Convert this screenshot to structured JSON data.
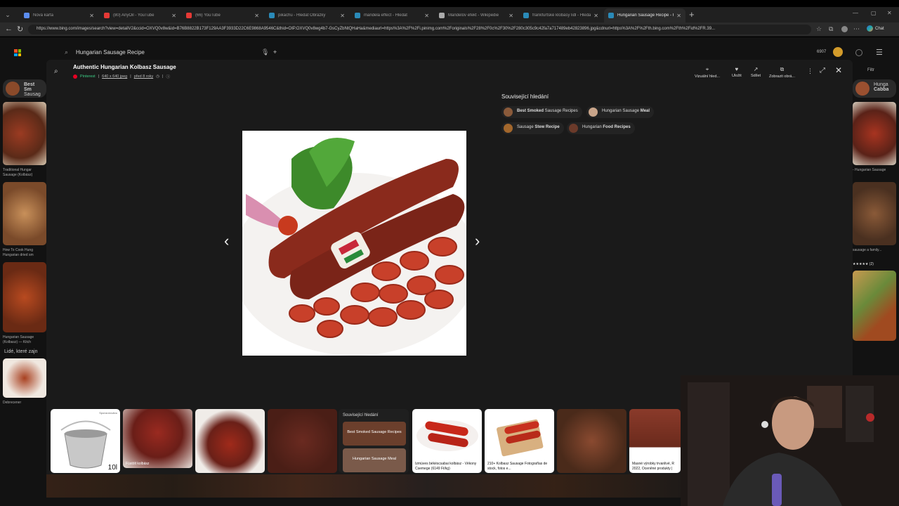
{
  "browser": {
    "tabs": [
      {
        "title": "Nová karta",
        "fav": "#5b8def",
        "active": false
      },
      {
        "title": "(80) AnyOil - YouTube",
        "fav": "#e53935",
        "active": false
      },
      {
        "title": "(66) YouTube",
        "fav": "#e53935",
        "active": false
      },
      {
        "title": "pikachu - Hledat Obrázky",
        "fav": "#2a8ab8",
        "active": false
      },
      {
        "title": "mandela effect - Hledat",
        "fav": "#2a8ab8",
        "active": false
      },
      {
        "title": "Mandelův efekt - Wikipedie",
        "fav": "#aaaaaa",
        "active": false
      },
      {
        "title": "frankfurtské klobásy lidl - Hledat",
        "fav": "#2a8ab8",
        "active": false
      },
      {
        "title": "Hungarian Sausage Recipe - Hledat",
        "fav": "#2a8ab8",
        "active": true
      }
    ],
    "url": "https://www.bing.com/images/search?view=detailV2&ccid=OXVQ0v8w&id=B76B8822B173F129AA3F3933D22C6E9868A9546C&thid=OIP.OXVQ0v8wg4b7-GsCyZbNtQHaHa&mediaurl=https%3A%2F%2Fi.pinimg.com%2Foriginals%2F28%2F0c%2F30%2F280c305c9c42fa7a717489eb42823896.jpg&cdnurl=https%3A%2F%2Fth.bing.com%2Fth%2Fid%2FR.39...",
    "chat_label": "Chat"
  },
  "bing": {
    "query": "Hungarian Sausage Recipe",
    "points": "6907",
    "filter_label": "Filtr",
    "left_pill": {
      "line1": "Best Sm",
      "line2": "Sausag"
    },
    "right_pill": {
      "line1": "Hunga",
      "line2": "Cabba"
    },
    "left_captions": [
      "Traditional Hungar Sausage (Kolbász)",
      "How To Cook Hung Hungarian dried sm",
      "Hungarian Sausage (Kolbasz) — Kitch"
    ],
    "right_captions": [
      "- Hungarian Sausage",
      "sausage a family...",
      ""
    ],
    "right_stars": "★★★★★ (2)",
    "people_also": "Lidé, které zajn",
    "people_caption": "Debrecener"
  },
  "detail": {
    "title": "Authentic Hungarian Kolbasz Sausage",
    "source": "Pinterest",
    "size": "640 x 640 jpeg",
    "age": "před 8 roky",
    "actions": [
      {
        "label": "Vizuální hled...",
        "icon": "⌖"
      },
      {
        "label": "Uložit",
        "icon": "♥"
      },
      {
        "label": "Sdílet",
        "icon": "↗"
      },
      {
        "label": "Zobrazit obrá...",
        "icon": "⧉"
      }
    ],
    "related_heading": "Související hledání",
    "related": [
      {
        "bold": "Best Smoked",
        "rest": " Sausage Recipes",
        "color": "#8a5a3a"
      },
      {
        "bold": "",
        "rest": "Hungarian Sausage ",
        "bold2": "Meal",
        "color": "#c9a58a"
      },
      {
        "bold": "",
        "rest": "Sausage ",
        "bold2": "Stew Recipe",
        "color": "#a3672c"
      },
      {
        "bold": "",
        "rest": "Hungarian ",
        "bold2": "Food Recipes",
        "color": "#6b3a2a"
      }
    ]
  },
  "filmstrip": {
    "sponsored": "Sponzorováno",
    "pot_size": "10l",
    "items": [
      {
        "caption": "Füstölt kolbász"
      },
      {
        "caption": ""
      },
      {
        "caption": ""
      },
      {
        "caption": "Izmüves békéscsabai kolbász - Vékony Csemege (6149 Ft/kg)"
      },
      {
        "caption": "210+ Kolbasz Sausage Fotografías de stock, fotos e..."
      },
      {
        "caption": ""
      },
      {
        "caption": "Masné výrobky trvanlivé, R 2022, Oceněné produkty |"
      }
    ],
    "related_heading": "Související hledání",
    "related_items": [
      "Best Smoked Sausage Recipes",
      "Hungarian Sausage Meal"
    ]
  }
}
